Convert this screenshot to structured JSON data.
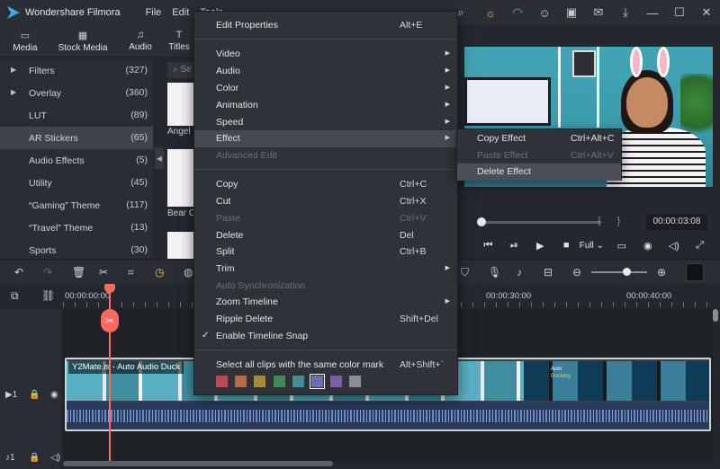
{
  "app": {
    "title": "Wondershare Filmora"
  },
  "menubar": [
    "File",
    "Edit",
    "Tools"
  ],
  "media_tabs": [
    "Media",
    "Stock Media",
    "Audio",
    "Titles"
  ],
  "sidebar": {
    "items": [
      {
        "label": "Filters",
        "count": "(327)",
        "expandable": true
      },
      {
        "label": "Overlay",
        "count": "(360)",
        "expandable": true
      },
      {
        "label": "LUT",
        "count": "(89)",
        "expandable": false
      },
      {
        "label": "AR Stickers",
        "count": "(65)",
        "expandable": false,
        "active": true
      },
      {
        "label": "Audio Effects",
        "count": "(5)",
        "expandable": false
      },
      {
        "label": "Utility",
        "count": "(45)",
        "expandable": false
      },
      {
        "label": "“Gaming” Theme",
        "count": "(117)",
        "expandable": false
      },
      {
        "label": "“Travel” Theme",
        "count": "(13)",
        "expandable": false
      },
      {
        "label": "Sports",
        "count": "(30)",
        "expandable": false
      }
    ]
  },
  "assets": {
    "search_placeholder": "Se",
    "items": [
      "Angel",
      "Bear Cl"
    ]
  },
  "player": {
    "timecode": "00:00:03:08",
    "quality": "Full"
  },
  "timeline": {
    "ruler": [
      "00:00:00:00",
      "00:00:30:00",
      "00:00:40:00"
    ],
    "clip_title": "Y2Mate.is - Auto Audio Duck",
    "preview_text": [
      "Auto",
      "Ducking"
    ],
    "tracks": [
      "1",
      "1"
    ]
  },
  "context_menu": {
    "items": [
      {
        "label": "Edit Properties",
        "shortcut": "Alt+E"
      },
      {
        "label": "Video",
        "submenu": true
      },
      {
        "label": "Audio",
        "submenu": true
      },
      {
        "label": "Color",
        "submenu": true
      },
      {
        "label": "Animation",
        "submenu": true
      },
      {
        "label": "Speed",
        "submenu": true
      },
      {
        "label": "Effect",
        "submenu": true,
        "highlighted": true
      },
      {
        "label": "Advanced Edit",
        "disabled": true
      },
      {
        "label": "Copy",
        "shortcut": "Ctrl+C"
      },
      {
        "label": "Cut",
        "shortcut": "Ctrl+X"
      },
      {
        "label": "Paste",
        "shortcut": "Ctrl+V",
        "disabled": true
      },
      {
        "label": "Delete",
        "shortcut": "Del"
      },
      {
        "label": "Split",
        "shortcut": "Ctrl+B"
      },
      {
        "label": "Trim",
        "submenu": true
      },
      {
        "label": "Auto Synchronization",
        "disabled": true
      },
      {
        "label": "Zoom Timeline",
        "submenu": true
      },
      {
        "label": "Ripple Delete",
        "shortcut": "Shift+Del"
      },
      {
        "label": "Enable Timeline Snap",
        "checked": true
      },
      {
        "label": "Select all clips with the same color mark",
        "shortcut": "Alt+Shift+`"
      }
    ],
    "color_marks": [
      "#b84a52",
      "#b86a45",
      "#a78a3c",
      "#3f8b57",
      "#3f8f96",
      "#6a6fb5",
      "#7a5fa8",
      "#8a8d94"
    ]
  },
  "effect_submenu": {
    "items": [
      {
        "label": "Copy Effect",
        "shortcut": "Ctrl+Alt+C"
      },
      {
        "label": "Paste Effect",
        "shortcut": "Ctrl+Alt+V",
        "disabled": true
      },
      {
        "label": "Delete Effect",
        "highlighted": true
      }
    ]
  }
}
